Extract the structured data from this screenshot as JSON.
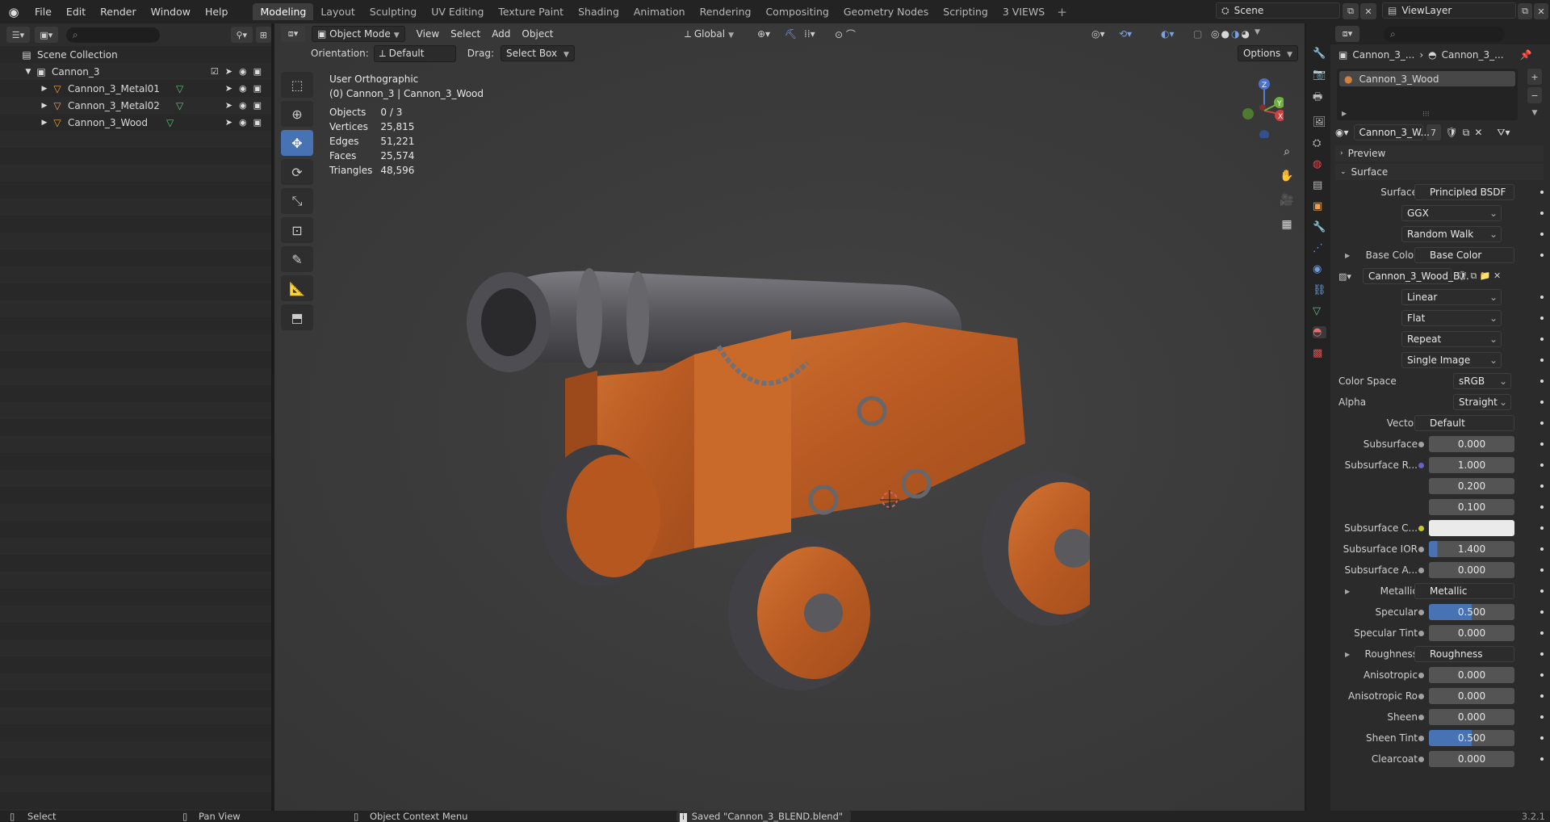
{
  "menu": [
    "File",
    "Edit",
    "Render",
    "Window",
    "Help"
  ],
  "workspaces": [
    "Modeling",
    "Layout",
    "Sculpting",
    "UV Editing",
    "Texture Paint",
    "Shading",
    "Animation",
    "Rendering",
    "Compositing",
    "Geometry Nodes",
    "Scripting",
    "3 VIEWS"
  ],
  "active_workspace": "Modeling",
  "scene": "Scene",
  "view_layer": "ViewLayer",
  "outliner": {
    "title": "Scene Collection",
    "collection": "Cannon_3",
    "objects": [
      "Cannon_3_Metal01",
      "Cannon_3_Metal02",
      "Cannon_3_Wood"
    ]
  },
  "viewport": {
    "mode": "Object Mode",
    "menus": [
      "View",
      "Select",
      "Add",
      "Object"
    ],
    "transform": "Global",
    "orientation_label": "Orientation:",
    "orientation": "Default",
    "drag_label": "Drag:",
    "drag": "Select Box",
    "options": "Options",
    "view_name": "User Orthographic",
    "object_info": "(0) Cannon_3 | Cannon_3_Wood",
    "stats": [
      {
        "label": "Objects",
        "value": "0 / 3"
      },
      {
        "label": "Vertices",
        "value": "25,815"
      },
      {
        "label": "Edges",
        "value": "51,221"
      },
      {
        "label": "Faces",
        "value": "25,574"
      },
      {
        "label": "Triangles",
        "value": "48,596"
      }
    ]
  },
  "properties": {
    "breadcrumb1": "Cannon_3_...",
    "breadcrumb2": "Cannon_3_...",
    "material_slot": "Cannon_3_Wood",
    "material_name": "Cannon_3_W...",
    "users": "7",
    "preview": "Preview",
    "surface_header": "Surface",
    "rows": [
      {
        "label": "Surface",
        "value": "Principled BSDF",
        "kind": "link",
        "socket": "#5fb85f"
      },
      {
        "label": "",
        "value": "GGX",
        "kind": "select"
      },
      {
        "label": "",
        "value": "Random Walk",
        "kind": "select"
      },
      {
        "label": "Base Color",
        "value": "Base Color",
        "kind": "link",
        "socket": "#c7c729",
        "expand": true
      },
      {
        "label": "",
        "value": "Cannon_3_Wood_B...",
        "kind": "image"
      },
      {
        "label": "",
        "value": "Linear",
        "kind": "select"
      },
      {
        "label": "",
        "value": "Flat",
        "kind": "select"
      },
      {
        "label": "",
        "value": "Repeat",
        "kind": "select"
      },
      {
        "label": "",
        "value": "Single Image",
        "kind": "select"
      },
      {
        "label": "Color Space",
        "value": "sRGB",
        "kind": "select-short"
      },
      {
        "label": "Alpha",
        "value": "Straight",
        "kind": "select-short"
      },
      {
        "label": "Vector",
        "value": "Default",
        "kind": "link",
        "socket": "#6363c7"
      },
      {
        "label": "Subsurface",
        "value": "0.000",
        "kind": "num",
        "socket": "#a1a1a1"
      },
      {
        "label": "Subsurface R...",
        "value": "1.000",
        "kind": "num",
        "socket": "#6363c7"
      },
      {
        "label": "",
        "value": "0.200",
        "kind": "num"
      },
      {
        "label": "",
        "value": "0.100",
        "kind": "num"
      },
      {
        "label": "Subsurface C...",
        "value": "",
        "kind": "color",
        "socket": "#c7c729"
      },
      {
        "label": "Subsurface IOR",
        "value": "1.400",
        "kind": "num",
        "socket": "#a1a1a1",
        "fill": 0.1
      },
      {
        "label": "Subsurface A...",
        "value": "0.000",
        "kind": "num",
        "socket": "#a1a1a1"
      },
      {
        "label": "Metallic",
        "value": "Metallic",
        "kind": "link",
        "socket": "#a1a1a1",
        "expand": true
      },
      {
        "label": "Specular",
        "value": "0.500",
        "kind": "num",
        "socket": "#a1a1a1",
        "fill": 0.5
      },
      {
        "label": "Specular Tint",
        "value": "0.000",
        "kind": "num",
        "socket": "#a1a1a1"
      },
      {
        "label": "Roughness",
        "value": "Roughness",
        "kind": "link",
        "socket": "#a1a1a1",
        "expand": true
      },
      {
        "label": "Anisotropic",
        "value": "0.000",
        "kind": "num",
        "socket": "#a1a1a1"
      },
      {
        "label": "Anisotropic Ro",
        "value": "0.000",
        "kind": "num",
        "socket": "#a1a1a1"
      },
      {
        "label": "Sheen",
        "value": "0.000",
        "kind": "num",
        "socket": "#a1a1a1"
      },
      {
        "label": "Sheen Tint",
        "value": "0.500",
        "kind": "num",
        "socket": "#a1a1a1",
        "fill": 0.5
      },
      {
        "label": "Clearcoat",
        "value": "0.000",
        "kind": "num",
        "socket": "#a1a1a1"
      }
    ]
  },
  "status": {
    "select": "Select",
    "pan": "Pan View",
    "context": "Object Context Menu",
    "message": "Saved \"Cannon_3_BLEND.blend\"",
    "version": "3.2.1"
  },
  "colors": {
    "accent": "#4772b3",
    "wood": "#c0662e",
    "metal": "#5a5a60"
  }
}
